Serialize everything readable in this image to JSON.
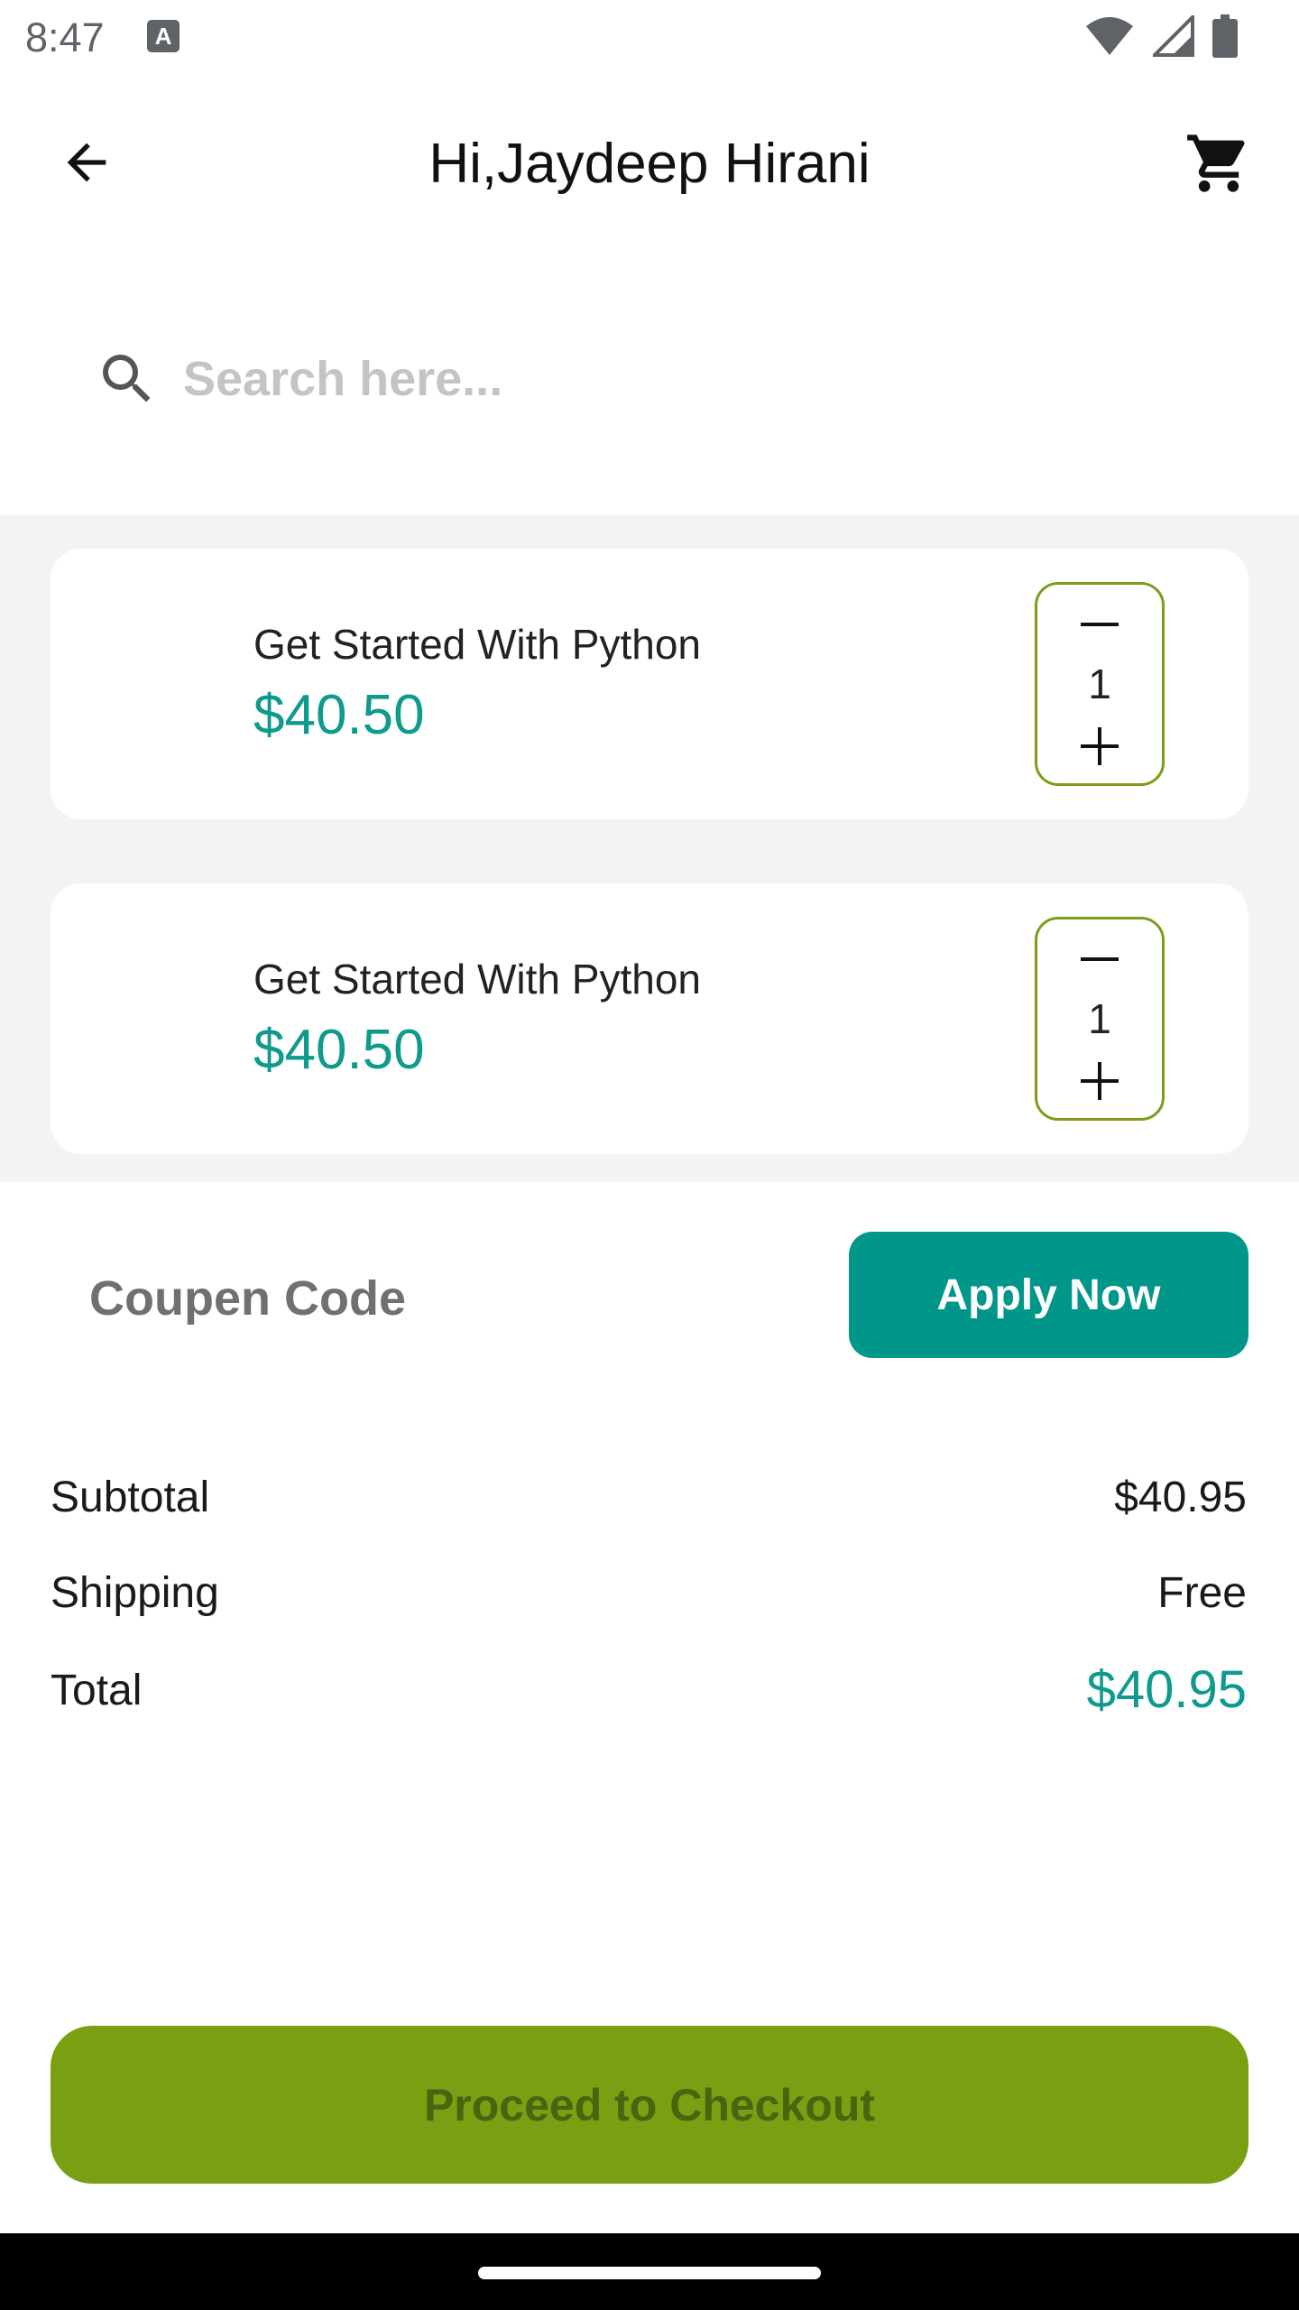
{
  "status_bar": {
    "time": "8:47",
    "notification_icon": "a-icon"
  },
  "app_bar": {
    "title": "Hi,Jaydeep Hirani",
    "back_icon": "arrow-left-icon",
    "cart_icon": "cart-icon"
  },
  "search": {
    "placeholder": "Search here...",
    "value": ""
  },
  "cart_items": [
    {
      "name": "Get Started With Python",
      "price": "$40.50",
      "quantity": "1"
    },
    {
      "name": "Get Started With Python",
      "price": "$40.50",
      "quantity": "1"
    }
  ],
  "coupon": {
    "label": "Coupen Code",
    "button": "Apply Now"
  },
  "summary": {
    "subtotal_label": "Subtotal",
    "subtotal_value": "$40.95",
    "shipping_label": "Shipping",
    "shipping_value": "Free",
    "total_label": "Total",
    "total_value": "$40.95"
  },
  "checkout": {
    "label": "Proceed to Checkout"
  },
  "colors": {
    "accent_teal": "#00968a",
    "accent_green": "#799f12",
    "price_teal": "#0e9a8c"
  }
}
